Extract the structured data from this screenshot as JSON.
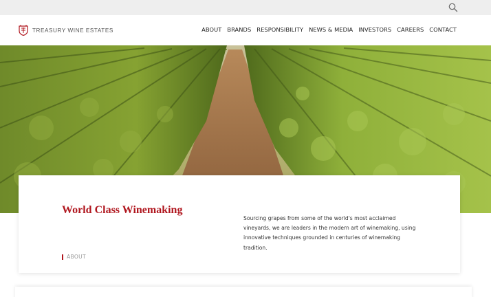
{
  "brand": {
    "name": "TREASURY WINE ESTATES",
    "accent_color": "#b0161e",
    "logo_icon": "crest-icon"
  },
  "utility": {
    "search_icon": "search-icon"
  },
  "nav": {
    "items": [
      {
        "label": "ABOUT"
      },
      {
        "label": "BRANDS"
      },
      {
        "label": "RESPONSIBILITY"
      },
      {
        "label": "NEWS & MEDIA"
      },
      {
        "label": "INVESTORS"
      },
      {
        "label": "CAREERS"
      },
      {
        "label": "CONTACT"
      }
    ]
  },
  "hero": {
    "image": "vineyard-rows-photo"
  },
  "feature": {
    "title": "World Class Winemaking",
    "body": "Sourcing grapes from some of the world's most acclaimed vineyards, we are leaders in the modern art of winemaking, using innovative techniques grounded in centuries of winemaking tradition.",
    "link_label": "ABOUT"
  }
}
